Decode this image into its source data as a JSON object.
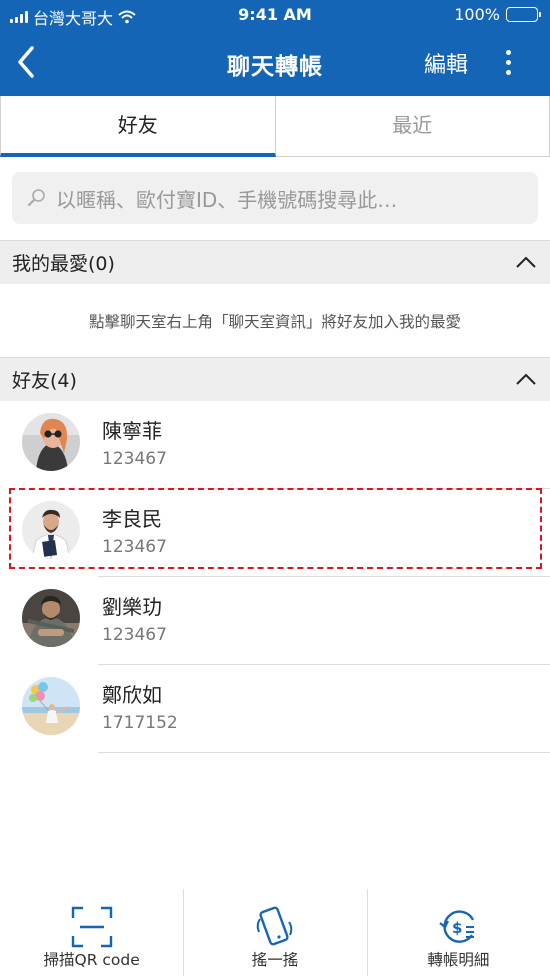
{
  "status_bar": {
    "carrier": "台灣大哥大",
    "time": "9:41 AM",
    "battery": "100%",
    "battery_level": 1.0
  },
  "nav": {
    "title": "聊天轉帳",
    "edit_label": "編輯",
    "back_icon": "chevron-left-icon",
    "more_icon": "more-vertical-icon"
  },
  "tabs": [
    {
      "label": "好友",
      "active": true
    },
    {
      "label": "最近",
      "active": false
    }
  ],
  "search": {
    "placeholder": "以暱稱、歐付寶ID、手機號碼搜尋此…",
    "icon": "search-icon"
  },
  "favorites": {
    "title": "我的最愛(0)",
    "hint": "點擊聊天室右上角「聊天室資訊」將好友加入我的最愛"
  },
  "friends": {
    "title": "好友(4)",
    "items": [
      {
        "name": "陳寧菲",
        "id": "123467"
      },
      {
        "name": "李良民",
        "id": "123467",
        "highlighted": true
      },
      {
        "name": "劉樂玏",
        "id": "123467"
      },
      {
        "name": "鄭欣如",
        "id": "1717152"
      }
    ]
  },
  "bottom_bar": [
    {
      "label": "掃描QR code",
      "icon": "qr-scan-icon"
    },
    {
      "label": "搖一搖",
      "icon": "shake-phone-icon"
    },
    {
      "label": "轉帳明細",
      "icon": "transfer-history-icon"
    }
  ],
  "colors": {
    "brand_blue": "#1565b7",
    "highlight_red": "#e0141b",
    "section_gray": "#eeeeee"
  }
}
